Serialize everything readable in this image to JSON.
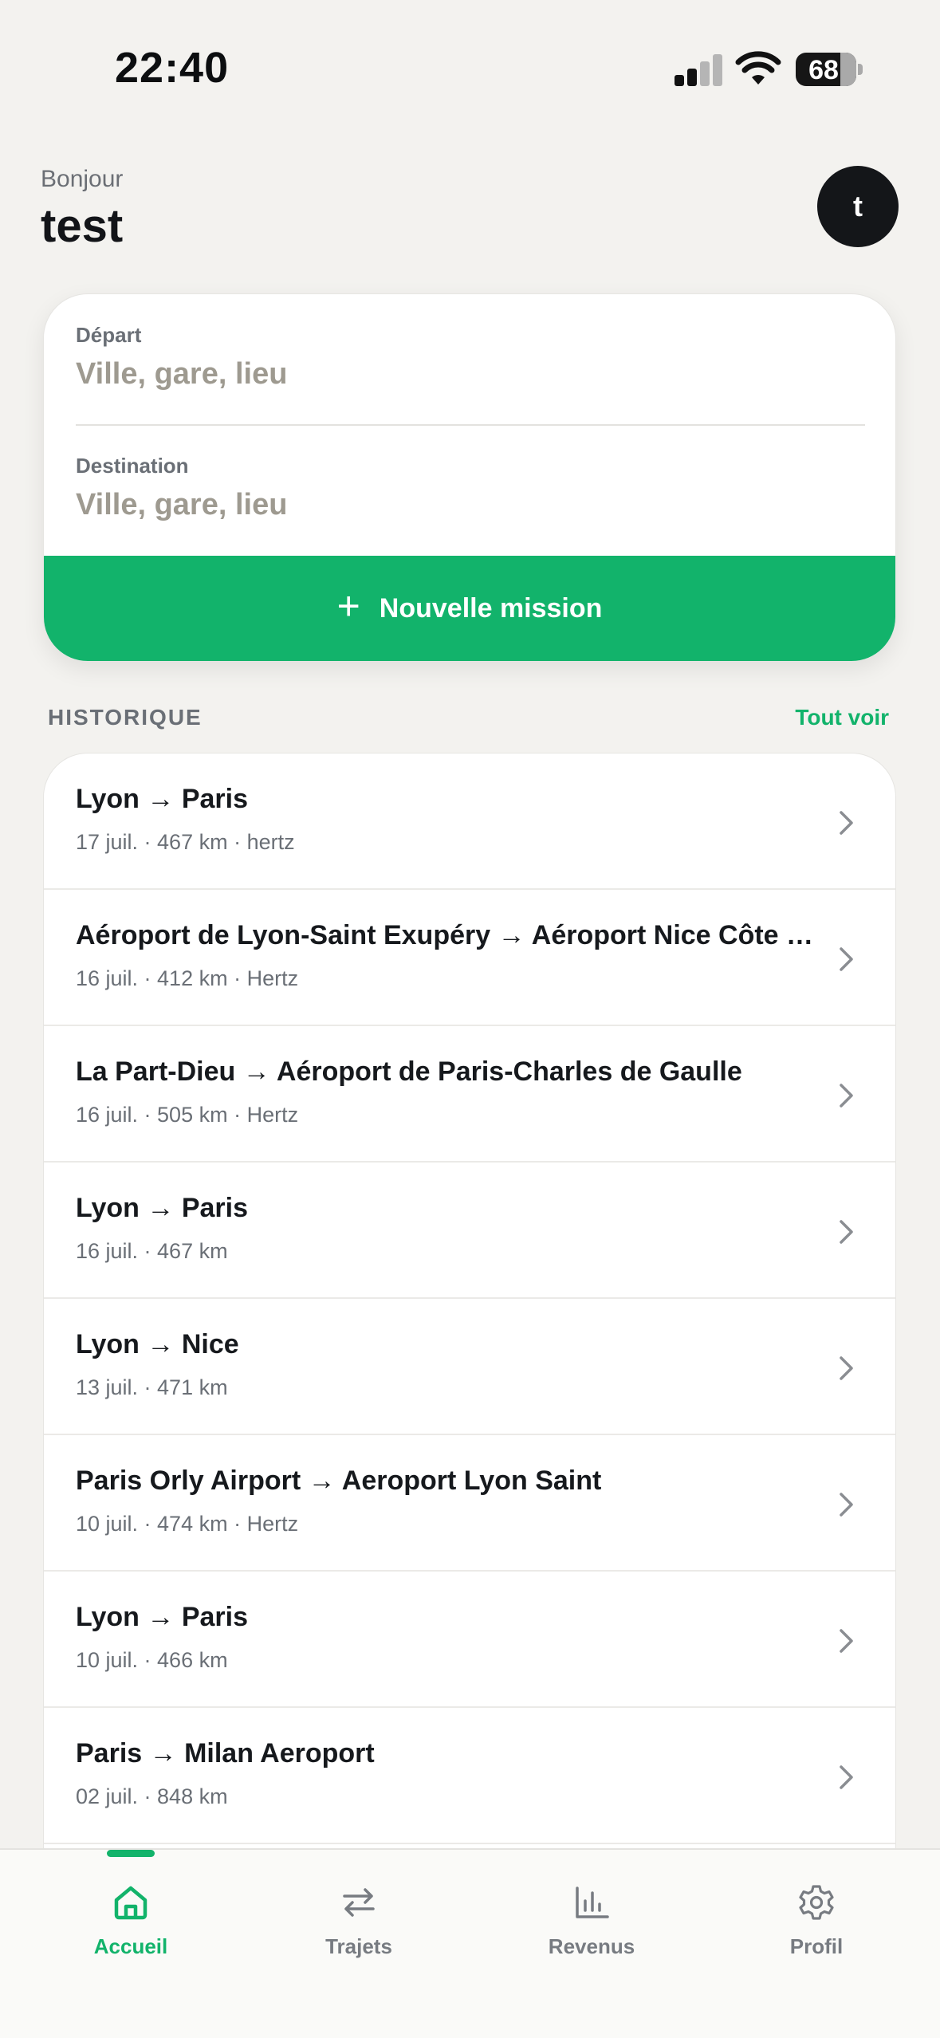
{
  "status_bar": {
    "time": "22:40",
    "battery": "68"
  },
  "header": {
    "greeting": "Bonjour",
    "username": "test",
    "avatar_initial": "t"
  },
  "search": {
    "departure_label": "Départ",
    "departure_placeholder": "Ville, gare, lieu",
    "destination_label": "Destination",
    "destination_placeholder": "Ville, gare, lieu",
    "new_mission_label": "Nouvelle mission"
  },
  "history": {
    "title": "HISTORIQUE",
    "see_all": "Tout voir",
    "items": [
      {
        "title": "Lyon → Paris",
        "meta": "17 juil. · 467 km · hertz"
      },
      {
        "title": "Aéroport de Lyon-Saint Exupéry → Aéroport Nice Côte d'Azur",
        "meta": "16 juil. · 412 km · Hertz"
      },
      {
        "title": "La Part-Dieu → Aéroport de Paris-Charles de Gaulle",
        "meta": "16 juil. · 505 km · Hertz"
      },
      {
        "title": "Lyon → Paris",
        "meta": "16 juil. · 467 km"
      },
      {
        "title": "Lyon → Nice",
        "meta": "13 juil. · 471 km"
      },
      {
        "title": "Paris Orly Airport → Aeroport Lyon Saint",
        "meta": "10 juil. · 474 km · Hertz"
      },
      {
        "title": "Lyon → Paris",
        "meta": "10 juil. · 466 km"
      },
      {
        "title": "Paris → Milan Aeroport",
        "meta": "02 juil. · 848 km"
      }
    ]
  },
  "tabs": [
    {
      "label": "Accueil",
      "icon": "home-icon",
      "active": true
    },
    {
      "label": "Trajets",
      "icon": "swap-arrows-icon",
      "active": false
    },
    {
      "label": "Revenus",
      "icon": "bar-chart-icon",
      "active": false
    },
    {
      "label": "Profil",
      "icon": "gear-icon",
      "active": false
    }
  ],
  "colors": {
    "accent": "#12b36b",
    "background": "#f3f2ef",
    "text_primary": "#16191d",
    "text_secondary": "#6a6f76",
    "tab_inactive": "#777b81"
  }
}
